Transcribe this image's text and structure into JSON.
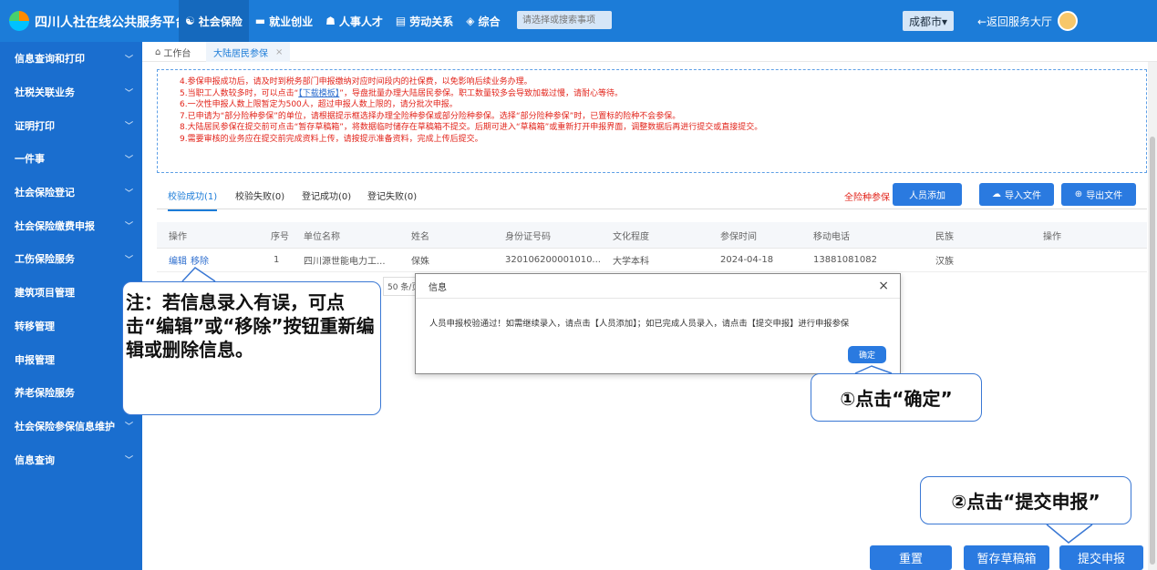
{
  "app": {
    "title": "四川人社在线公共服务平台",
    "nav": [
      {
        "icon": "☯",
        "label": "社会保险",
        "active": true
      },
      {
        "icon": "▬",
        "label": "就业创业"
      },
      {
        "icon": "☗",
        "label": "人事人才"
      },
      {
        "icon": "▤",
        "label": "劳动关系"
      },
      {
        "icon": "◈",
        "label": "综合"
      }
    ],
    "search_placeholder": "请选择或搜索事项",
    "city": "成都市▾",
    "back": "←返回服务大厅"
  },
  "sidebar": {
    "items": [
      "信息查询和打印",
      "社税关联业务",
      "证明打印",
      "一件事",
      "社会保险登记",
      "社会保险缴费申报",
      "工伤保险服务",
      "建筑项目管理",
      "转移管理",
      "申报管理",
      "养老保险服务",
      "社会保险参保信息维护",
      "信息查询"
    ]
  },
  "tabs": {
    "home": "工作台",
    "active": "大陆居民参保",
    "close": "×"
  },
  "notice": {
    "line4": "4.参保申报成功后，请及时到税务部门申报缴纳对应时间段内的社保费，以免影响后续业务办理。",
    "line5_pre": "5.当职工人数较多时，可以点击“",
    "line5_link": "【下载模板】",
    "line5_post": "”，导盘批量办理大陆居民参保。职工数量较多会导致加载过慢，请耐心等待。",
    "line6": "6.一次性申报人数上限暂定为500人，超过申报人数上限的，请分批次申报。",
    "line7": "7.已申请为“部分险种参保”的单位，请根据提示框选择办理全险种参保或部分险种参保。选择“部分险种参保”时，已置标的险种不会参保。",
    "line8": "8.大陆居民参保在提交前可点击“暂存草稿箱”，将数据临时储存在草稿箱不提交。后期可进入“草稿箱”或重新打开申报界面，调整数据后再进行提交或直接提交。",
    "line9": "9.需要审核的业务应在提交前完成资料上传，请按提示准备资料，完成上传后提交。"
  },
  "result_tabs": [
    "校验成功(1)",
    "校验失败(0)",
    "登记成功(0)",
    "登记失败(0)"
  ],
  "actions": {
    "all_risk": "全险种参保",
    "add": "人员添加",
    "import": "导入文件",
    "export": "导出文件"
  },
  "table": {
    "headers": [
      "操作",
      "序号",
      "单位名称",
      "姓名",
      "身份证号码",
      "文化程度",
      "参保时间",
      "移动电话",
      "民族",
      "操作"
    ],
    "row": {
      "edit": "编辑",
      "remove": "移除",
      "seq": "1",
      "company": "四川源世能电力工...",
      "name": "保姝",
      "id": "320106200001010...",
      "education": "大学本科",
      "date": "2024-04-18",
      "phone": "13881081082",
      "ethnicity": "汉族"
    }
  },
  "pager": {
    "text": "50 条/页"
  },
  "dialog": {
    "title": "信息",
    "close": "×",
    "message": "人员申报校验通过！如需继续录入，请点击【人员添加】；如已完成人员录入，请点击【提交申报】进行申报参保",
    "ok": "确定"
  },
  "callouts": {
    "note": "注：若信息录入有误，可点击“编辑”或“移除”按钮重新编辑或删除信息。",
    "step1": "①点击“确定”",
    "step2": "②点击“提交申报”"
  },
  "bottom": {
    "reset": "重置",
    "draft": "暂存草稿箱",
    "submit": "提交申报"
  },
  "colors": {
    "primary": "#1c7cd8",
    "sidebar": "#1a6ecf",
    "button": "#2a7ae0",
    "warning": "#e2231a",
    "callout_border": "#3a78d4"
  }
}
